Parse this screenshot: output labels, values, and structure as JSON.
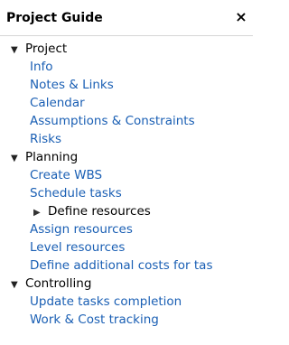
{
  "panel": {
    "title": "Project Guide",
    "close_glyph": "×"
  },
  "sections": [
    {
      "label": "Project",
      "icon": "triangle-down-icon",
      "items": [
        "Info",
        "Notes & Links",
        "Calendar",
        "Assumptions & Constraints",
        "Risks"
      ]
    },
    {
      "label": "Planning",
      "icon": "triangle-down-icon",
      "items": [
        "Create WBS",
        "Schedule tasks"
      ],
      "subgroup": {
        "label": "Define resources",
        "icon": "triangle-right-icon"
      },
      "items_after": [
        "Assign resources",
        "Level resources",
        "Define additional costs for tas"
      ]
    },
    {
      "label": "Controlling",
      "icon": "triangle-down-icon",
      "items": [
        "Update tasks completion",
        "Work & Cost tracking"
      ]
    }
  ],
  "glyphs": {
    "expanded": "▼",
    "collapsed": "▶"
  },
  "colors": {
    "link": "#1a5fb4",
    "text": "#000000"
  }
}
